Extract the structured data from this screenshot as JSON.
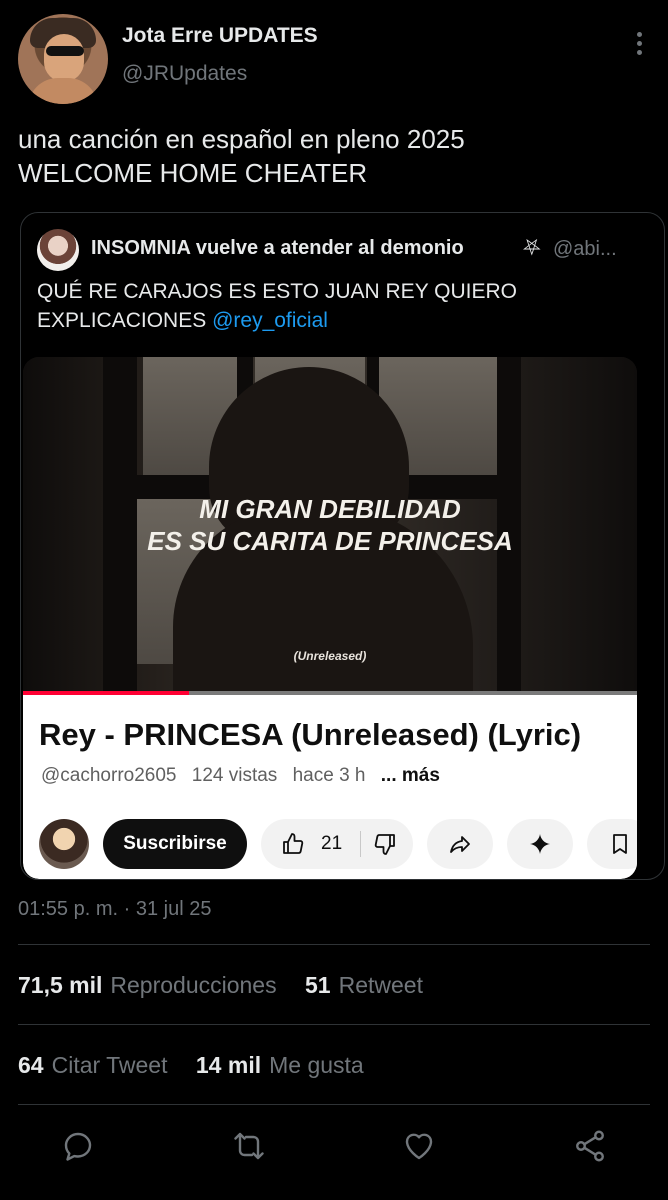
{
  "author": {
    "display_name": "Jota Erre UPDATES",
    "handle": "@JRUpdates"
  },
  "tweet": {
    "text_line1": "una canción en español en pleno 2025",
    "text_line2": "WELCOME HOME CHEATER"
  },
  "quoted_tweet": {
    "display_name": "INSOMNIA vuelve a atender al demonio",
    "name_emoji": "⛧",
    "handle": "@abi...",
    "text_line1": "QUÉ RE CARAJOS ES ESTO JUAN REY QUIERO",
    "text_line2_prefix": "EXPLICACIONES",
    "mention": "@rey_oficial",
    "media": {
      "lyric_line1": "MI GRAN DEBILIDAD",
      "lyric_line2": "ES SU CARITA DE PRINCESA",
      "caption": "(Unreleased)",
      "progress": 0.27
    },
    "youtube": {
      "title": "Rey - PRINCESA (Unreleased) (Lyric)",
      "channel": "@cachorro2605",
      "views": "124 vistas",
      "age": "hace 3 h",
      "more": "... más",
      "subscribe_label": "Suscribirse",
      "like_count": "21"
    }
  },
  "timestamp": "01:55 p. m. · 31 jul 25",
  "stats": {
    "views_count": "71,5 mil",
    "views_label": "Reproducciones",
    "retweets_count": "51",
    "retweets_label": "Retweet",
    "quotes_count": "64",
    "quotes_label": "Citar Tweet",
    "likes_count": "14 mil",
    "likes_label": "Me gusta"
  },
  "colors": {
    "background": "#000000",
    "text": "#e7e9ea",
    "secondary": "#71767b",
    "link": "#1d9bf0",
    "youtube_red": "#ff0033"
  },
  "icons": [
    "more-vertical-icon",
    "like-icon",
    "dislike-icon",
    "share-icon",
    "sparkle-icon",
    "save-icon",
    "reply-icon",
    "retweet-icon",
    "heart-icon",
    "share-network-icon"
  ]
}
